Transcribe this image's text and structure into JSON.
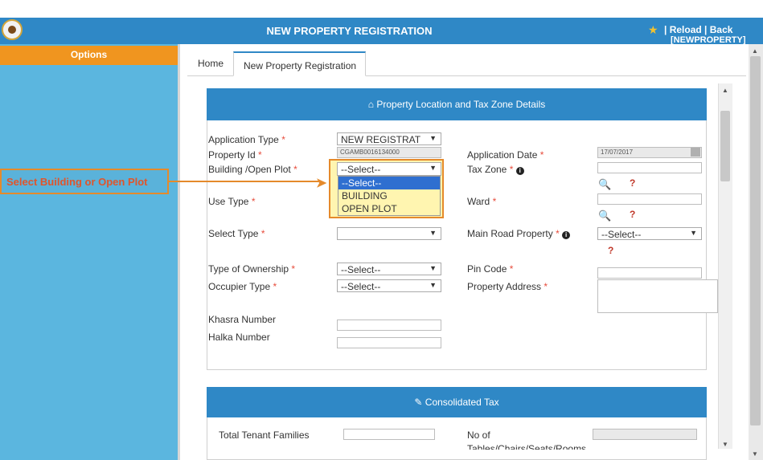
{
  "header": {
    "title": "NEW PROPERTY REGISTRATION",
    "links": "| Reload |   Back",
    "sublink": "[NEWPROPERTY]"
  },
  "sidebar": {
    "options_label": "Options"
  },
  "tabs": {
    "home": "Home",
    "current": "New Property Registration"
  },
  "callout": {
    "text": "Select Building or Open Plot"
  },
  "section1": {
    "title": "Property Location and Tax Zone Details",
    "application_type": {
      "label": "Application Type",
      "value": "NEW REGISTRAT"
    },
    "property_id": {
      "label": "Property Id",
      "value": "CGAMB0016134000"
    },
    "application_date": {
      "label": "Application Date",
      "value": "17/07/2017"
    },
    "building_open_plot": {
      "label": "Building /Open Plot",
      "value": "--Select--",
      "options": [
        "--Select--",
        "BUILDING",
        "OPEN PLOT"
      ]
    },
    "tax_zone": {
      "label": "Tax Zone"
    },
    "use_type": {
      "label": "Use Type"
    },
    "ward": {
      "label": "Ward"
    },
    "select_type": {
      "label": "Select Type"
    },
    "main_road_property": {
      "label": "Main Road Property",
      "value": "--Select--"
    },
    "type_of_ownership": {
      "label": "Type of Ownership",
      "value": "--Select--"
    },
    "pin_code": {
      "label": "Pin Code"
    },
    "occupier_type": {
      "label": "Occupier Type",
      "value": "--Select--"
    },
    "property_address": {
      "label": "Property Address"
    },
    "khasra_number": {
      "label": "Khasra Number"
    },
    "halka_number": {
      "label": "Halka Number"
    }
  },
  "section2": {
    "title": "Consolidated Tax",
    "total_tenant_families": {
      "label": "Total Tenant Families"
    },
    "no_of": {
      "label": "No of",
      "label2": "Tables/Chairs/Seats/Rooms"
    }
  },
  "required_mark": "*",
  "help_mark": "?",
  "colors": {
    "header": "#2f88c6",
    "sidebar": "#5bb6df",
    "options": "#f0951f",
    "highlight": "#e58a2b"
  }
}
